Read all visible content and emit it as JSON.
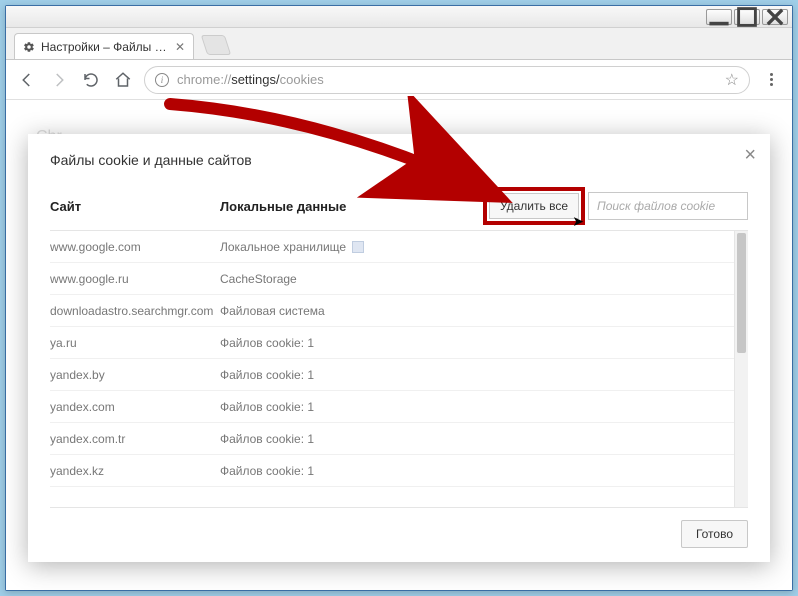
{
  "tab": {
    "title": "Настройки – Файлы coo"
  },
  "url": {
    "scheme": "chrome://",
    "path_a": "settings/",
    "path_b": "cookies"
  },
  "behind": {
    "peek": "Chr"
  },
  "modal": {
    "title": "Файлы cookie и данные сайтов",
    "th_site": "Сайт",
    "th_local": "Локальные данные",
    "delete_all": "Удалить все",
    "search_placeholder": "Поиск файлов cookie",
    "done": "Готово",
    "rows": [
      {
        "site": "www.google.com",
        "local": "Локальное хранилище",
        "chip": true
      },
      {
        "site": "www.google.ru",
        "local": "CacheStorage",
        "chip": false
      },
      {
        "site": "downloadastro.searchmgr.com",
        "local": "Файловая система",
        "chip": false
      },
      {
        "site": "ya.ru",
        "local": "Файлов cookie: 1",
        "chip": false
      },
      {
        "site": "yandex.by",
        "local": "Файлов cookie: 1",
        "chip": false
      },
      {
        "site": "yandex.com",
        "local": "Файлов cookie: 1",
        "chip": false
      },
      {
        "site": "yandex.com.tr",
        "local": "Файлов cookie: 1",
        "chip": false
      },
      {
        "site": "yandex.kz",
        "local": "Файлов cookie: 1",
        "chip": false
      }
    ]
  }
}
